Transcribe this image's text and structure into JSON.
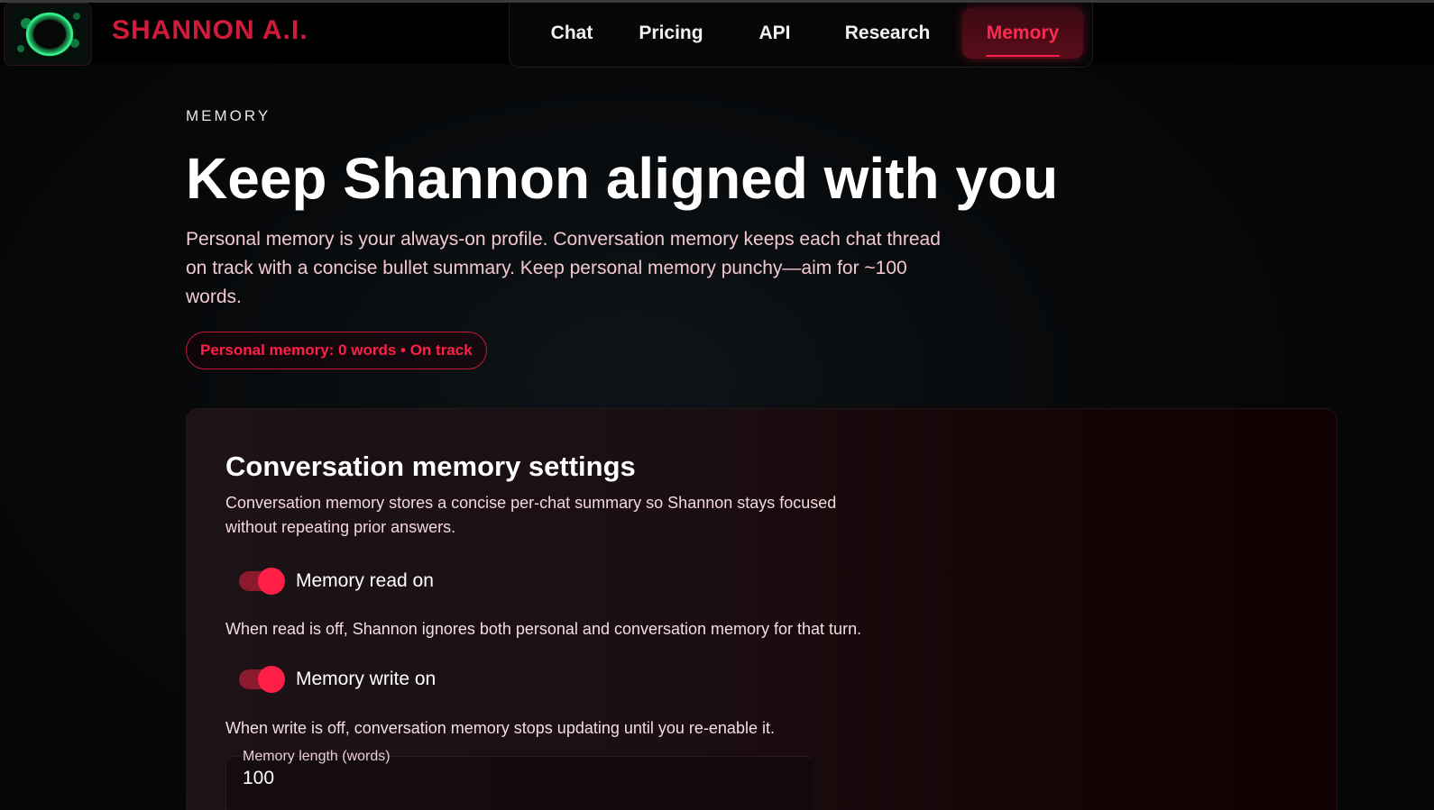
{
  "brand": {
    "name": "SHANNON A.I.",
    "logo": "green-orb-logo"
  },
  "nav": {
    "items": [
      {
        "label": "Chat"
      },
      {
        "label": "Pricing"
      },
      {
        "label": "API"
      },
      {
        "label": "Research"
      },
      {
        "label": "Memory"
      }
    ],
    "active": "Memory"
  },
  "intro": {
    "eyebrow": "MEMORY",
    "title": "Keep Shannon aligned with you",
    "description": "Personal memory is your always-on profile. Conversation memory keeps each chat thread on track with a concise bullet summary. Keep personal memory punchy—aim for ~100 words.",
    "status_pill": "Personal memory: 0 words • On track"
  },
  "conversation_settings": {
    "title": "Conversation memory settings",
    "description": "Conversation memory stores a concise per-chat summary so Shannon stays focused without repeating prior answers.",
    "read_toggle": {
      "label": "Memory read on",
      "on": true
    },
    "read_help": "When read is off, Shannon ignores both personal and conversation memory for that turn.",
    "write_toggle": {
      "label": "Memory write on",
      "on": true
    },
    "write_help": "When write is off, conversation memory stops updating until you re-enable it.",
    "length_field": {
      "label": "Memory length (words)",
      "value": "100"
    }
  },
  "colors": {
    "accent": "#ff1f47",
    "brand": "#d11b3a",
    "background": "#050607",
    "card": "#1b0f12"
  }
}
